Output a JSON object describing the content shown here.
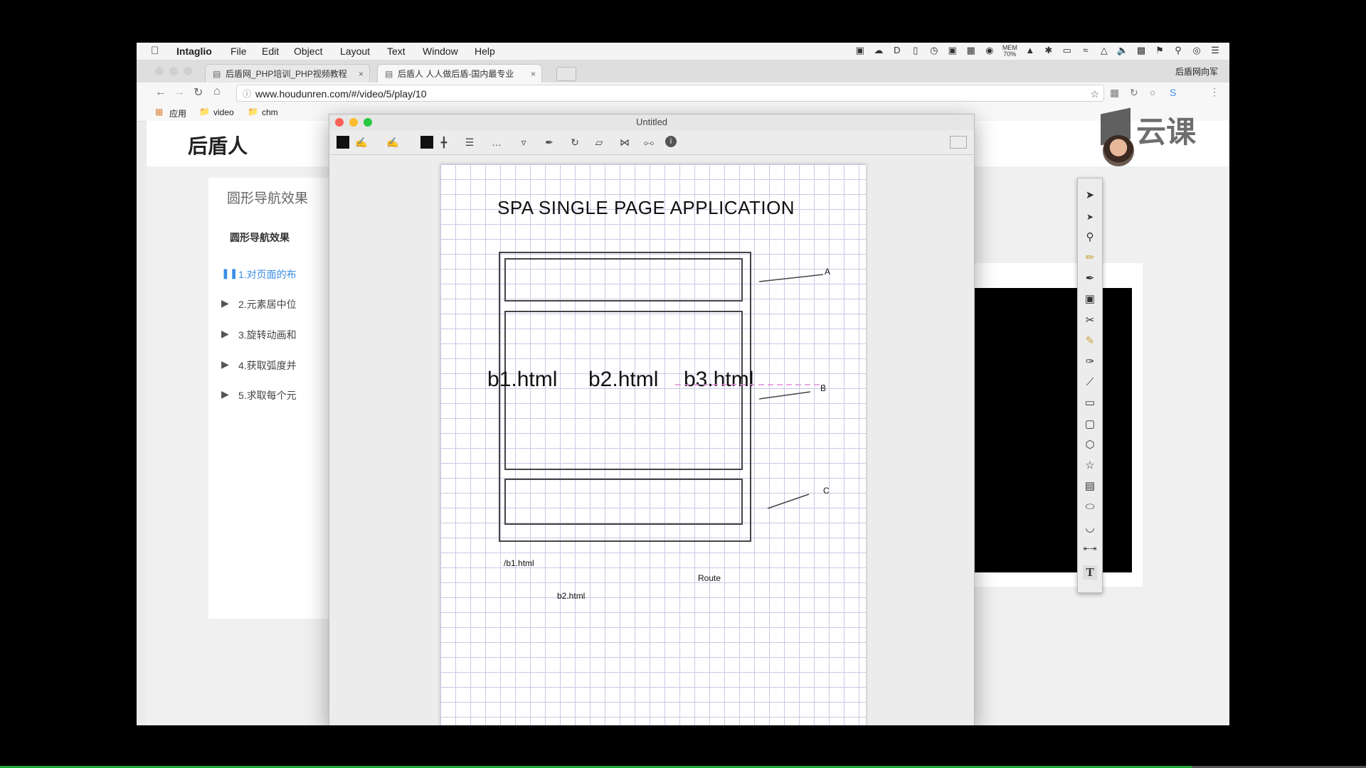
{
  "menubar": {
    "app_name": "Intaglio",
    "menus": [
      "File",
      "Edit",
      "Object",
      "Layout",
      "Text",
      "Window",
      "Help"
    ],
    "status": {
      "mem_label": "MEM",
      "mem_value": "70%"
    }
  },
  "browser": {
    "tabs": [
      {
        "title": "后盾网_PHP培训_PHP视频教程"
      },
      {
        "title": "后盾人 人人做后盾-国内最专业"
      }
    ],
    "profile_name": "后盾网向军",
    "url": "www.houdunren.com/#/video/5/play/10",
    "bookmarks": [
      {
        "label": "应用",
        "icon": "apps-grid-icon"
      },
      {
        "label": "video",
        "icon": "folder-icon"
      },
      {
        "label": "chm",
        "icon": "folder-icon"
      }
    ]
  },
  "site": {
    "logo": "后盾人",
    "section_title": "圆形导航效果",
    "chapter_title": "圆形导航效果",
    "lessons": [
      {
        "label": "1.对页面的布",
        "active": true
      },
      {
        "label": "2.元素居中位",
        "active": false
      },
      {
        "label": "3.旋转动画和",
        "active": false
      },
      {
        "label": "4.获取弧度并",
        "active": false
      },
      {
        "label": "5.求取每个元",
        "active": false
      }
    ]
  },
  "intaglio": {
    "window_title": "Untitled",
    "drawing": {
      "heading": "SPA  SINGLE  PAGE APPLICATION",
      "content_labels": [
        "b1.html",
        "b2.html",
        "b3.html"
      ],
      "callouts": [
        "A",
        "B",
        "C"
      ],
      "notes": {
        "route_path": "/b1.html",
        "route_word": "Route",
        "file_b2": "b2.html"
      }
    }
  },
  "watermark": {
    "brand": "云课"
  },
  "colors": {
    "accent_link": "#3a8ee6",
    "progress": "#1ea83a",
    "grid": "#c9c9e6"
  }
}
